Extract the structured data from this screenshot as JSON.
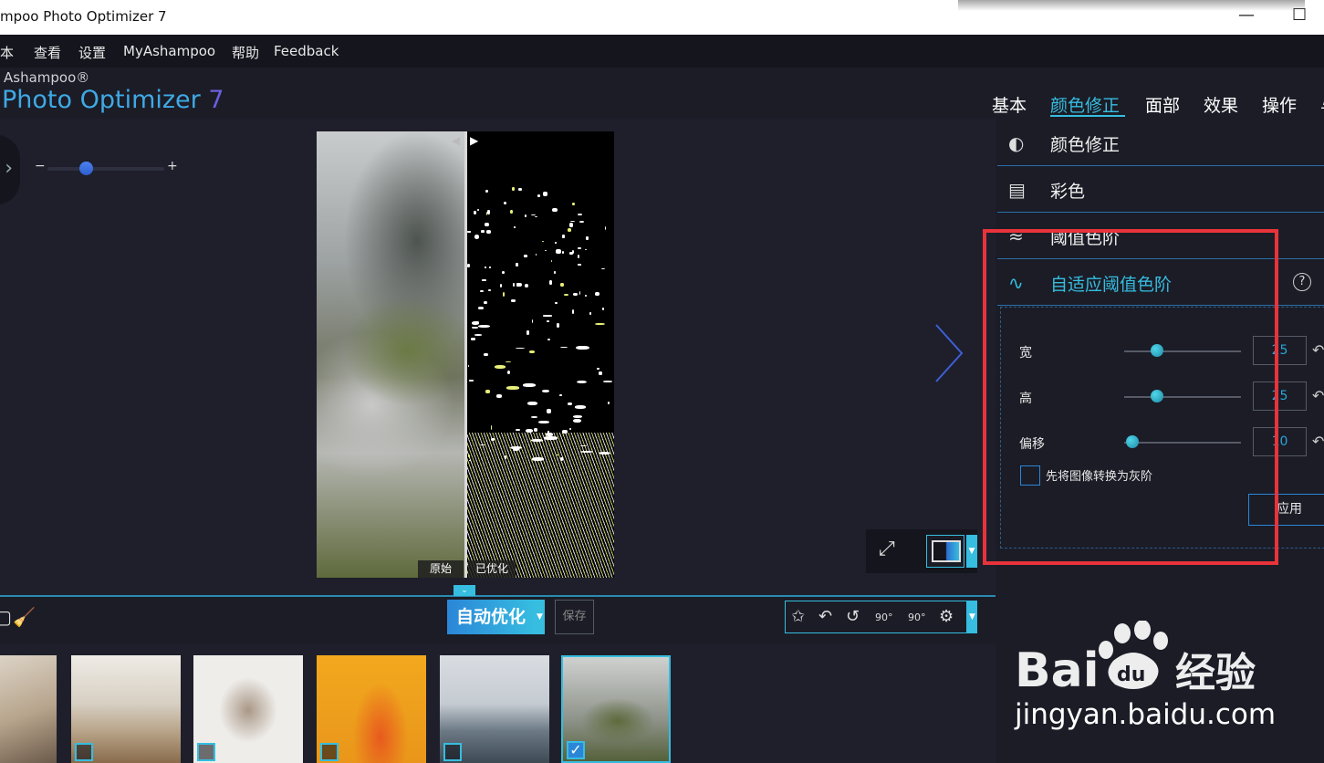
{
  "window": {
    "title": "mpoo Photo Optimizer 7",
    "restore_icon": "☐"
  },
  "menu": {
    "items": [
      "本",
      "查看",
      "设置",
      "MyAshampoo",
      "帮助",
      "Feedback"
    ]
  },
  "brand": {
    "top": "Ashampoo®",
    "name": "Photo Optimizer",
    "version": "7"
  },
  "tabs": [
    {
      "label": "基本"
    },
    {
      "label": "颜色修正",
      "active": true
    },
    {
      "label": "面部"
    },
    {
      "label": "效果"
    },
    {
      "label": "操作"
    },
    {
      "label": "与"
    }
  ],
  "canvas": {
    "zoom_minus": "−",
    "zoom_plus": "+",
    "zoom_level_fraction": 0.33,
    "label_original": "原始",
    "label_optimized": "已优化"
  },
  "toolbar": {
    "auto_optimize": "自动优化",
    "save": "保存",
    "rotate_left_label": "90°",
    "rotate_right_label": "90°"
  },
  "panel": {
    "items": [
      {
        "label": "颜色修正",
        "icon": "brightness-contrast-icon"
      },
      {
        "label": "彩色",
        "icon": "histogram-icon"
      },
      {
        "label": "阈值色阶",
        "icon": "threshold-icon"
      },
      {
        "label": "自适应阈值色阶",
        "icon": "adaptive-threshold-icon",
        "active": true
      }
    ],
    "help_icon": "?",
    "params": {
      "width": {
        "label": "宽",
        "value": "25",
        "slider_fraction": 0.28
      },
      "height": {
        "label": "高",
        "value": "25",
        "slider_fraction": 0.28
      },
      "offset": {
        "label": "偏移",
        "value": "10",
        "slider_fraction": 0.07
      }
    },
    "grayscale_label": "先将图像转换为灰阶",
    "grayscale_checked": false,
    "apply": "应用"
  },
  "filmstrip": {
    "selected_index": 5,
    "selected_mark": "✓"
  },
  "watermark": {
    "logo": "Bai du 经验",
    "url": "jingyan.baidu.com"
  },
  "colors": {
    "accent": "#36bde0",
    "highlight": "#e8333a"
  }
}
